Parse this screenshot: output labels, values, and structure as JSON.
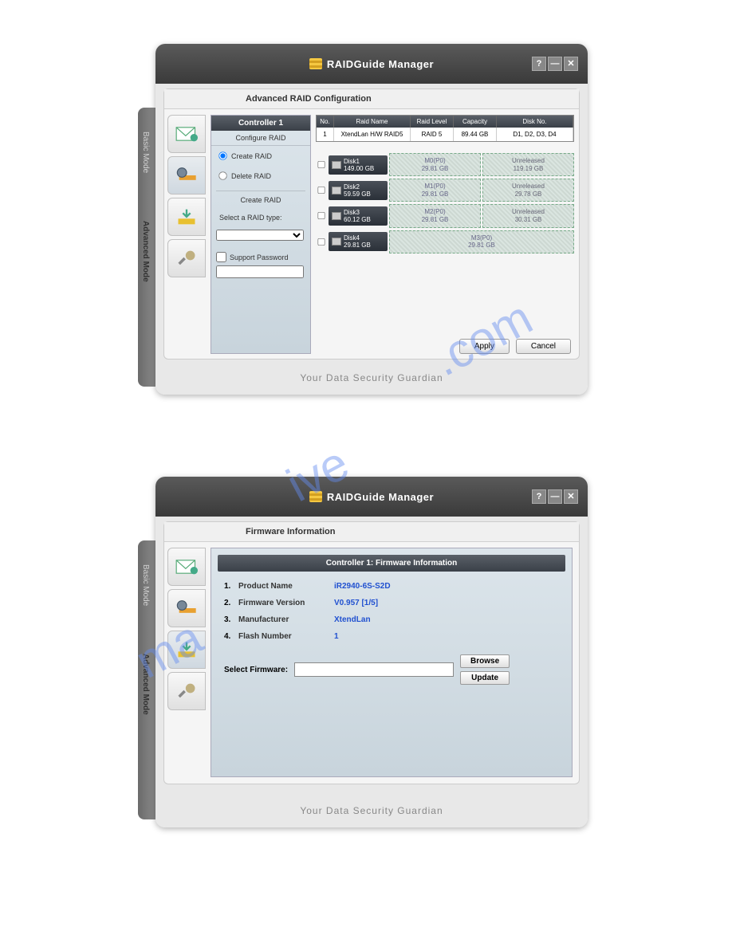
{
  "app_title": "RAIDGuide Manager",
  "win_controls": {
    "help": "?",
    "min": "—",
    "close": "✕"
  },
  "side_tabs": {
    "basic": "Basic Mode",
    "advanced": "Advanced Mode"
  },
  "footer": "Your Data Security Guardian",
  "screen1": {
    "section_title": "Advanced RAID Configuration",
    "left": {
      "header": "Controller 1",
      "sub": "Configure RAID",
      "radio_create": "Create RAID",
      "radio_delete": "Delete RAID",
      "box_label": "Create RAID",
      "select_label": "Select a RAID type:",
      "pass_label": "Support Password"
    },
    "table": {
      "headers": {
        "no": "No.",
        "name": "Raid Name",
        "level": "Raid Level",
        "cap": "Capacity",
        "disk": "Disk No."
      },
      "row": {
        "no": "1",
        "name": "XtendLan H/W RAID5",
        "level": "RAID 5",
        "cap": "89.44 GB",
        "disk": "D1, D2, D3, D4"
      }
    },
    "disks": [
      {
        "label": "Disk1",
        "size": "149.00 GB",
        "p1": "M0(P0)",
        "p1s": "29.81 GB",
        "p2": "Unreleased",
        "p2s": "119.19 GB"
      },
      {
        "label": "Disk2",
        "size": "59.59 GB",
        "p1": "M1(P0)",
        "p1s": "29.81 GB",
        "p2": "Unreleased",
        "p2s": "29.78 GB"
      },
      {
        "label": "Disk3",
        "size": "60.12 GB",
        "p1": "M2(P0)",
        "p1s": "29.81 GB",
        "p2": "Unreleased",
        "p2s": "30.31 GB"
      },
      {
        "label": "Disk4",
        "size": "29.81 GB",
        "p1": "M3(P0)",
        "p1s": "29.81 GB"
      }
    ],
    "actions": {
      "apply": "Apply",
      "cancel": "Cancel"
    }
  },
  "screen2": {
    "section_title": "Firmware Information",
    "header": "Controller 1: Firmware Information",
    "rows": [
      {
        "n": "1.",
        "label": "Product Name",
        "val": "iR2940-6S-S2D"
      },
      {
        "n": "2.",
        "label": "Firmware Version",
        "val": "V0.957 [1/5]"
      },
      {
        "n": "3.",
        "label": "Manufacturer",
        "val": "XtendLan"
      },
      {
        "n": "4.",
        "label": "Flash Number",
        "val": "1"
      }
    ],
    "select_label": "Select Firmware:",
    "browse": "Browse",
    "update": "Update"
  }
}
